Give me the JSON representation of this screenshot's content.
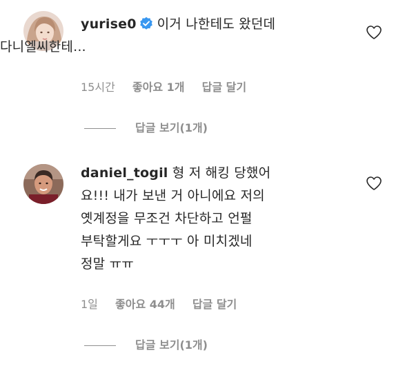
{
  "comments": [
    {
      "username": "yurise0",
      "verified": true,
      "text_line1": "이거 나한테도 왔던데",
      "text_line2": "다니엘씨한테...",
      "time": "15시간",
      "likes": "좋아요 1개",
      "reply": "답글 달기",
      "view_replies": "답글 보기(1개)",
      "like_icon": "heart-outline-icon"
    },
    {
      "username": "daniel_togil",
      "verified": false,
      "text_line1": "형 저 해킹 당했어",
      "text_line2": "요!!! 내가 보낸 거 아니에요 저의",
      "text_line3": "옛계정을 무조건 차단하고 언펄",
      "text_line4": "부탁할게요 ㅜㅜㅜ 아 미치겠네",
      "text_line5": "정말 ㅠㅠ",
      "time": "1일",
      "likes": "좋아요 44개",
      "reply": "답글 달기",
      "view_replies": "답글 보기(1개)",
      "like_icon": "heart-outline-icon"
    }
  ],
  "colors": {
    "text": "#262626",
    "muted": "#8e8e8e",
    "verified": "#3897f0"
  }
}
